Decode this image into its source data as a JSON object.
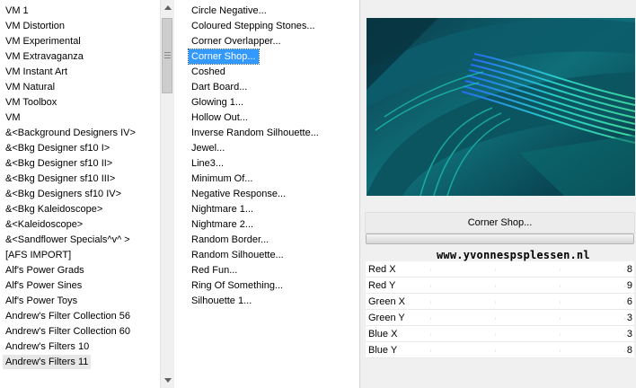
{
  "left_list": {
    "items": [
      "VM 1",
      "VM Distortion",
      "VM Experimental",
      "VM Extravaganza",
      "VM Instant Art",
      "VM Natural",
      "VM Toolbox",
      "VM",
      "&<Background Designers IV>",
      "&<Bkg Designer sf10 I>",
      "&<Bkg Designer sf10 II>",
      "&<Bkg Designer sf10 III>",
      "&<Bkg Designers sf10 IV>",
      "&<Bkg Kaleidoscope>",
      "&<Kaleidoscope>",
      "&<Sandflower Specials^v^ >",
      "[AFS IMPORT]",
      "Alf's Power Grads",
      "Alf's Power Sines",
      "Alf's Power Toys",
      "Andrew's Filter Collection 56",
      "Andrew's Filter Collection 60",
      "Andrew's Filters 10",
      "Andrew's Filters 11"
    ],
    "selected_index": 23
  },
  "filter_list": {
    "items": [
      "Circle Negative...",
      "Coloured Stepping Stones...",
      "Corner Overlapper...",
      "Corner Shop...",
      "Coshed",
      "Dart Board...",
      "Glowing 1...",
      "Hollow Out...",
      "Inverse Random Silhouette...",
      "Jewel...",
      "Line3...",
      "Minimum Of...",
      "Negative Response...",
      "Nightmare 1...",
      "Nightmare 2...",
      "Random Border...",
      "Random Silhouette...",
      "Red Fun...",
      "Ring Of Something...",
      "Silhouette 1..."
    ],
    "selected_index": 3
  },
  "right_panel": {
    "filter_button_label": "Corner Shop...",
    "watermark": "www.yvonnespsplessen.nl",
    "params": [
      {
        "name": "Red X",
        "value": "8"
      },
      {
        "name": "Red Y",
        "value": "9"
      },
      {
        "name": "Green X",
        "value": "6"
      },
      {
        "name": "Green Y",
        "value": "3"
      },
      {
        "name": "Blue X",
        "value": "3"
      },
      {
        "name": "Blue Y",
        "value": "8"
      }
    ]
  },
  "colors": {
    "selection": "#3399ff",
    "panel_bg": "#f0f0f0"
  }
}
